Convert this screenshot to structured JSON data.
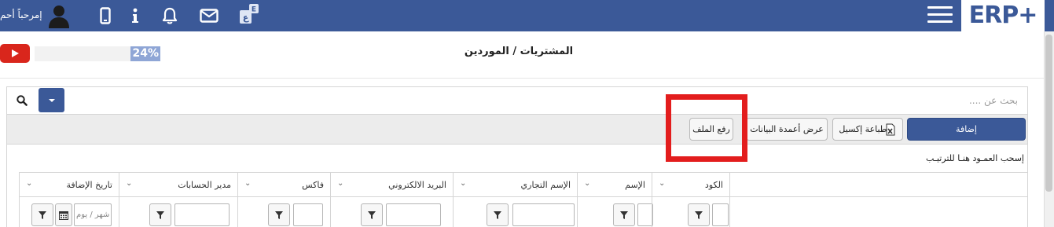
{
  "topbar": {
    "logo_text": "ERP",
    "logo_plus": "+",
    "welcome_text": "إمرحباً أحم",
    "brand_color": "#3b5998"
  },
  "header": {
    "page_title": "المشتريات / الموردين",
    "progress_label": "24%",
    "progress_value": 24
  },
  "search": {
    "placeholder": "بحث عن ...."
  },
  "toolbar": {
    "add_label": "إضافة",
    "excel_label": "طباعة إكسيل",
    "columns_label": "عرض أعمدة البيانات",
    "upload_label": "رفع الملف"
  },
  "grid": {
    "group_hint": "إسحب العمـود هنـا للترتيـب",
    "columns": [
      {
        "label": "الكود"
      },
      {
        "label": "الإسم"
      },
      {
        "label": "الإسم التجاري"
      },
      {
        "label": "البريد الالكتروني"
      },
      {
        "label": "فاكس"
      },
      {
        "label": "مدير الحسابات"
      },
      {
        "label": "تاريخ الإضافة"
      }
    ],
    "date_placeholder": "شهر / يوم"
  },
  "icons": {
    "youtube": "youtube-play-icon",
    "search": "search-icon",
    "filter": "filter-icon",
    "calendar": "calendar-icon"
  }
}
